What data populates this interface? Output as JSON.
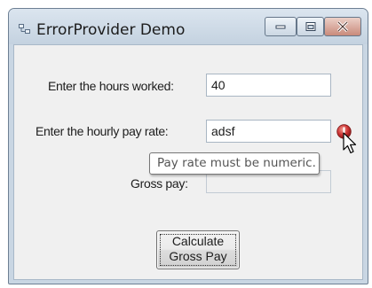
{
  "window": {
    "title": "ErrorProvider Demo"
  },
  "form": {
    "hours_label": "Enter the hours worked:",
    "hours_value": "40",
    "rate_label": "Enter the hourly pay rate:",
    "rate_value": "adsf",
    "gross_label": "Gross pay:",
    "gross_value": "",
    "error_tooltip": "Pay rate must be numeric.",
    "calculate_button": {
      "line1": "Calculate",
      "line2": "Gross Pay"
    }
  },
  "icons": {
    "app": "form-icon",
    "minimize": "minimize-icon",
    "maximize": "maximize-icon",
    "close": "close-icon",
    "error": "error-icon",
    "cursor": "arrow-cursor-icon"
  },
  "colors": {
    "error_icon": "#cc3333",
    "window_frame": "#c9d6e3",
    "client_bg": "#f0f0f0"
  }
}
